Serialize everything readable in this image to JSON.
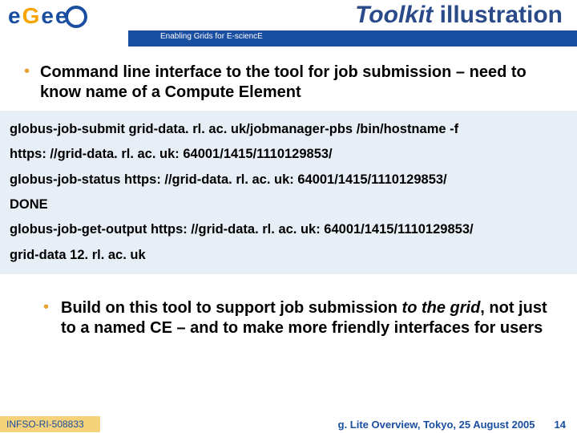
{
  "header": {
    "logo_letters": "eGee",
    "tagline": "Enabling Grids for E-sciencE",
    "title_toolkit": "Toolkit",
    "title_illustration": " illustration"
  },
  "bullet1": {
    "text_a": "Command line interface to the tool for job submission – need to know name of a Compute Element"
  },
  "code": {
    "l1": "globus-job-submit grid-data. rl. ac. uk/jobmanager-pbs /bin/hostname -f",
    "l2": "https: //grid-data. rl. ac. uk: 64001/1415/1110129853/",
    "l3": "globus-job-status https: //grid-data. rl. ac. uk: 64001/1415/1110129853/",
    "l4": "DONE",
    "l5": "globus-job-get-output https: //grid-data. rl. ac. uk: 64001/1415/1110129853/",
    "l6": "grid-data 12. rl. ac. uk"
  },
  "bullet2": {
    "a": "Build on this tool to support job submission ",
    "b_it": "to the grid",
    "c": ", not just to a named CE – and to make more friendly interfaces for users"
  },
  "footer": {
    "left": "INFSO-RI-508833",
    "right": "g. Lite Overview, Tokyo, 25 August 2005",
    "page": "14"
  }
}
